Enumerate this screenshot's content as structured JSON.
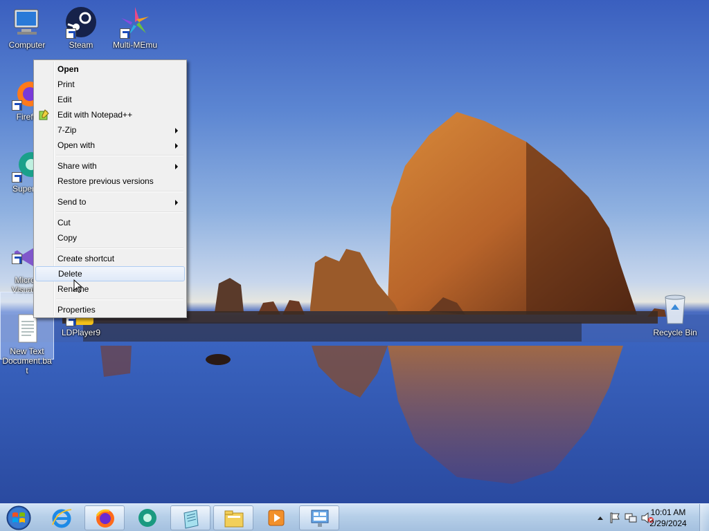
{
  "desktop_icons": [
    {
      "key": "computer",
      "label": "Computer",
      "icon": "computer-icon"
    },
    {
      "key": "steam",
      "label": "Steam",
      "icon": "steam-icon"
    },
    {
      "key": "multimemu",
      "label": "Multi-MEmu",
      "icon": "multi-memu-icon"
    },
    {
      "key": "firefox",
      "label": "Firefo",
      "icon": "firefox-icon"
    },
    {
      "key": "supermium",
      "label": "Superm",
      "icon": "supermium-icon"
    },
    {
      "key": "vstudio",
      "label": "Micros\nVisual S",
      "icon": "visual-studio-icon"
    },
    {
      "key": "newtext",
      "label": "New Text\nDocument.ba\nt",
      "icon": "text-document-icon"
    },
    {
      "key": "ldplayer",
      "label": "LDPlayer9",
      "icon": "ldplayer-icon"
    },
    {
      "key": "recycle",
      "label": "Recycle Bin",
      "icon": "recycle-bin-icon"
    }
  ],
  "context_menu": {
    "items": [
      {
        "label": "Open",
        "bold": true
      },
      {
        "label": "Print"
      },
      {
        "label": "Edit"
      },
      {
        "label": "Edit with Notepad++",
        "icon": "notepad-plus-plus-icon"
      },
      {
        "label": "7-Zip",
        "submenu": true
      },
      {
        "label": "Open with",
        "submenu": true
      },
      {
        "separator": true
      },
      {
        "label": "Share with",
        "submenu": true
      },
      {
        "label": "Restore previous versions"
      },
      {
        "separator": true
      },
      {
        "label": "Send to",
        "submenu": true
      },
      {
        "separator": true
      },
      {
        "label": "Cut"
      },
      {
        "label": "Copy"
      },
      {
        "separator": true
      },
      {
        "label": "Create shortcut"
      },
      {
        "label": "Delete",
        "highlighted": true
      },
      {
        "label": "Rename"
      },
      {
        "separator": true
      },
      {
        "label": "Properties"
      }
    ]
  },
  "taskbar": {
    "pinned": [
      {
        "name": "internet-explorer-icon"
      },
      {
        "name": "firefox-icon"
      },
      {
        "name": "supermium-icon"
      },
      {
        "name": "notepad-icon"
      },
      {
        "name": "file-explorer-icon"
      },
      {
        "name": "media-player-icon"
      },
      {
        "name": "control-panel-icon"
      }
    ],
    "tray_icons": [
      "show-hidden-icons-icon",
      "action-center-flag-icon",
      "network-icon",
      "volume-muted-icon"
    ],
    "clock": {
      "time": "10:01 AM",
      "date": "2/29/2024"
    }
  },
  "colors": {
    "sky_top": "#3a5fbf",
    "menu_bg": "#f0f0f0",
    "menu_highlight": "#dfe9f8",
    "taskbar": "#b6cfe8"
  }
}
